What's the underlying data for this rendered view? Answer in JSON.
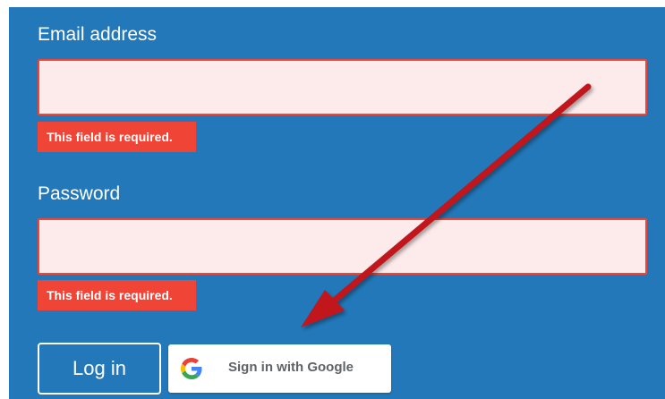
{
  "form": {
    "email_label": "Email address",
    "email_value": "",
    "email_error": "This field is required.",
    "password_label": "Password",
    "password_value": "",
    "password_error": "This field is required.",
    "login_label": "Log in",
    "google_label": "Sign in with Google"
  },
  "colors": {
    "panel_bg": "#2278b9",
    "error_bg": "#ef4436",
    "field_bg": "#fdebeb",
    "annotation_arrow": "#c0131b"
  },
  "icons": {
    "google": "google-g-icon",
    "annotation": "red-arrow-annotation-icon"
  }
}
